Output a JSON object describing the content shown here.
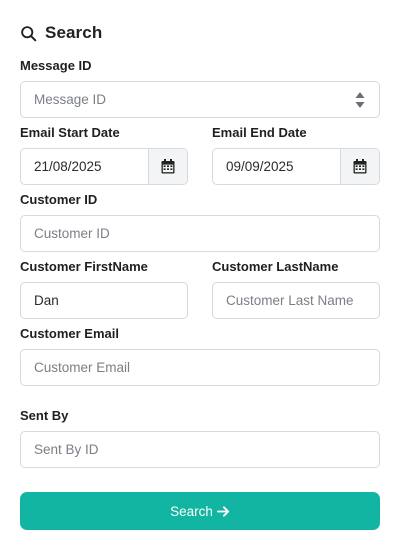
{
  "header": {
    "title": "Search",
    "icon": "search-icon"
  },
  "message_id": {
    "label": "Message ID",
    "placeholder": "Message ID"
  },
  "email_start_date": {
    "label": "Email Start Date",
    "value": "21/08/2025"
  },
  "email_end_date": {
    "label": "Email End Date",
    "value": "09/09/2025"
  },
  "customer_id": {
    "label": "Customer ID",
    "placeholder": "Customer ID"
  },
  "customer_firstname": {
    "label": "Customer FirstName",
    "value": "Dan"
  },
  "customer_lastname": {
    "label": "Customer LastName",
    "placeholder": "Customer Last Name"
  },
  "customer_email": {
    "label": "Customer Email",
    "placeholder": "Customer Email"
  },
  "sent_by": {
    "label": "Sent By",
    "placeholder": "Sent By ID"
  },
  "submit": {
    "label": "Search",
    "icon": "arrow-right-icon",
    "color": "#12b5a2"
  }
}
